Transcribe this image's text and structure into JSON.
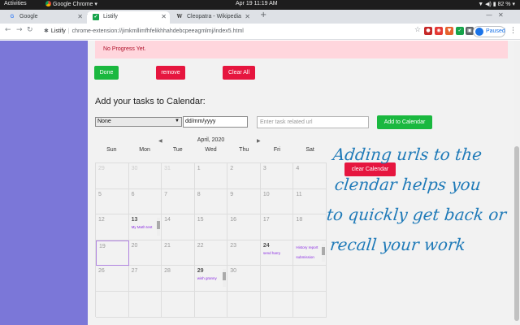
{
  "topbar": {
    "activities": "Activities",
    "app": "Google Chrome",
    "clock": "Apr 19  11:19 AM",
    "battery": "82 %"
  },
  "tabs": [
    {
      "title": "Google",
      "favicon": "google-favicon",
      "active": false
    },
    {
      "title": "Listify",
      "favicon": "listify-favicon",
      "active": true
    },
    {
      "title": "Cleopatra - Wikipedia",
      "favicon": "wikipedia-favicon",
      "active": false
    }
  ],
  "toolbar": {
    "site_name": "Listify",
    "url": "chrome-extension://jimkmllimfhfelikhhahdebcpeeagmlmj/index5.html",
    "paused_label": "Paused"
  },
  "page": {
    "progress_text": "No Progress Yet.",
    "buttons": {
      "done": "Done",
      "remove": "remove",
      "clear_all": "Clear All",
      "add_calendar": "Add to Calendar",
      "clear_calendar": "clear Calendar"
    },
    "heading": "Add your tasks to Calendar:",
    "select_value": "None",
    "date_placeholder": "dd/mm/yyyy",
    "url_placeholder": "Enter task related url"
  },
  "calendar": {
    "month": "April, 2020",
    "weekdays": [
      "Sun",
      "Mon",
      "Tue",
      "Wed",
      "Thu",
      "Fri",
      "Sat"
    ],
    "cells": [
      {
        "d": "29",
        "other": true
      },
      {
        "d": "30",
        "other": true
      },
      {
        "d": "31",
        "other": true
      },
      {
        "d": "1"
      },
      {
        "d": "2"
      },
      {
        "d": "3"
      },
      {
        "d": "4"
      },
      {
        "d": "5"
      },
      {
        "d": "6"
      },
      {
        "d": "7"
      },
      {
        "d": "8"
      },
      {
        "d": "9"
      },
      {
        "d": "10"
      },
      {
        "d": "11"
      },
      {
        "d": "12"
      },
      {
        "d": "13",
        "bold": true,
        "tasks": [
          "My Math test"
        ],
        "scroll": true
      },
      {
        "d": "14"
      },
      {
        "d": "15"
      },
      {
        "d": "16"
      },
      {
        "d": "17"
      },
      {
        "d": "18"
      },
      {
        "d": "19",
        "today": true
      },
      {
        "d": "20"
      },
      {
        "d": "21"
      },
      {
        "d": "22"
      },
      {
        "d": "23"
      },
      {
        "d": "24",
        "bold": true,
        "tasks": [
          "send harry"
        ]
      },
      {
        "d": "",
        "tasks": [
          "History report",
          "submission"
        ],
        "scroll": true
      },
      {
        "d": "26"
      },
      {
        "d": "27"
      },
      {
        "d": "28"
      },
      {
        "d": "29",
        "bold": true,
        "tasks": [
          "wish granny"
        ],
        "scroll": true
      },
      {
        "d": "30"
      },
      {
        "d": ""
      },
      {
        "d": ""
      },
      {
        "d": ""
      },
      {
        "d": ""
      },
      {
        "d": ""
      },
      {
        "d": ""
      },
      {
        "d": ""
      },
      {
        "d": ""
      },
      {
        "d": ""
      }
    ]
  },
  "promo_lines": [
    "Adding urls to the",
    "clendar helps you",
    "to quickly get back or",
    "recall your work"
  ],
  "colors": {
    "sidebar": "#7b77d8",
    "green": "#1ab83f",
    "red": "#e6163f",
    "promo": "#1f7ab8"
  }
}
